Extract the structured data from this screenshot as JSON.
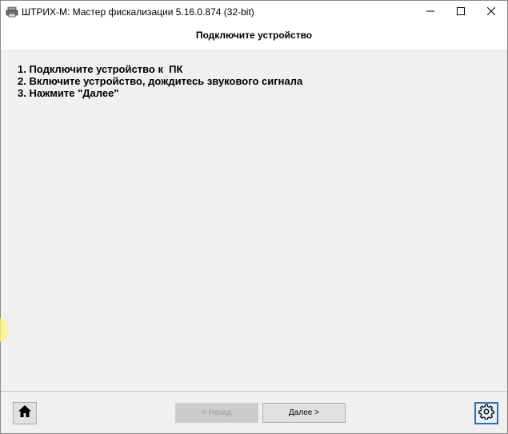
{
  "window": {
    "title": "ШТРИХ-М: Мастер фискализации 5.16.0.874 (32-bit)",
    "controls": {
      "minimize_icon": "minimize-icon",
      "maximize_icon": "maximize-icon",
      "close_icon": "close-icon"
    }
  },
  "page": {
    "title": "Подключите устройство"
  },
  "steps": [
    "1. Подключите устройство к  ПК",
    "2. Включите устройство, дождитесь звукового сигнала",
    "3. Нажмите \"Далее\""
  ],
  "footer": {
    "home_icon": "home-icon",
    "back_label": "< Назад",
    "back_enabled": false,
    "next_label": "Далее >",
    "settings_icon": "gear-icon"
  },
  "colors": {
    "background": "#f0f0f0",
    "header_background": "#ffffff",
    "settings_border": "#2f6fb5"
  }
}
